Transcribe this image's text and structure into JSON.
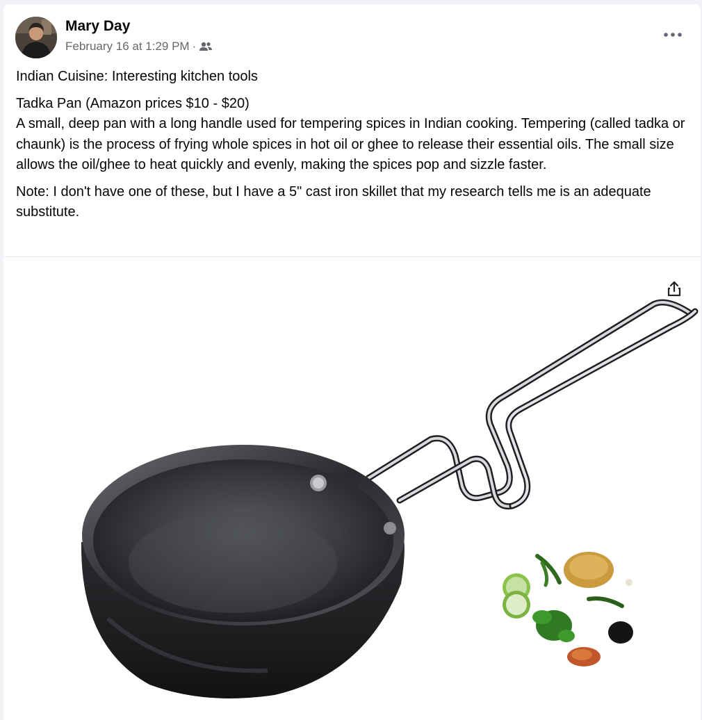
{
  "post": {
    "author": {
      "name": "Mary Day",
      "avatar_icon": "profile-photo"
    },
    "timestamp": "February 16 at 1:29 PM",
    "separator": "·",
    "audience_icon": "friends-icon",
    "more_icon": "more-horizontal-icon",
    "paragraphs": [
      "Indian Cuisine: Interesting kitchen tools",
      "Tadka Pan (Amazon prices $10 - $20)",
      "A small, deep pan with a long handle used for tempering spices in Indian cooking. Tempering (called tadka or chaunk) is the process of frying whole spices in hot oil or ghee to release their essential oils. The small size allows the oil/ghee to heat quickly and evenly, making the spices pop and sizzle faster.",
      "Note: I don't have one of these, but I have a 5\" cast iron skillet that my research tells me is an adequate substitute."
    ],
    "media": {
      "subject": "tadka-pan-with-spices",
      "share_icon": "share-icon"
    }
  }
}
